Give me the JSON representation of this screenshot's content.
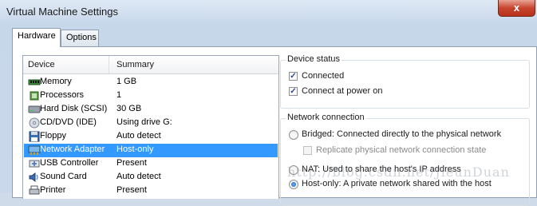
{
  "window": {
    "title": "Virtual Machine Settings",
    "close_label": "x"
  },
  "tabs": [
    {
      "label": "Hardware"
    },
    {
      "label": "Options"
    }
  ],
  "device_list": {
    "col_device": "Device",
    "col_summary": "Summary",
    "rows": [
      {
        "device": "Memory",
        "summary": "1 GB",
        "icon": "memory-icon"
      },
      {
        "device": "Processors",
        "summary": "1",
        "icon": "processor-icon"
      },
      {
        "device": "Hard Disk (SCSI)",
        "summary": "30 GB",
        "icon": "hard-disk-icon"
      },
      {
        "device": "CD/DVD (IDE)",
        "summary": "Using drive G:",
        "icon": "cd-dvd-icon"
      },
      {
        "device": "Floppy",
        "summary": "Auto detect",
        "icon": "floppy-icon"
      },
      {
        "device": "Network Adapter",
        "summary": "Host-only",
        "icon": "network-adapter-icon",
        "selected": true
      },
      {
        "device": "USB Controller",
        "summary": "Present",
        "icon": "usb-icon"
      },
      {
        "device": "Sound Card",
        "summary": "Auto detect",
        "icon": "sound-card-icon"
      },
      {
        "device": "Printer",
        "summary": "Present",
        "icon": "printer-icon"
      }
    ]
  },
  "device_status": {
    "legend": "Device status",
    "connected": {
      "label": "Connected",
      "checked": true
    },
    "connect_at_power_on": {
      "label": "Connect at power on",
      "checked": true
    }
  },
  "network_connection": {
    "legend": "Network connection",
    "bridged": {
      "label": "Bridged: Connected directly to the physical network",
      "selected": false
    },
    "replicate": {
      "label": "Replicate physical network connection state",
      "checked": false,
      "disabled": true
    },
    "nat": {
      "label": "NAT: Used to share the host's IP address",
      "selected": false
    },
    "host_only": {
      "label": "Host-only: A private network shared with the host",
      "selected": true
    }
  },
  "watermark": "http://blog.csdn.net/JieunDuan"
}
